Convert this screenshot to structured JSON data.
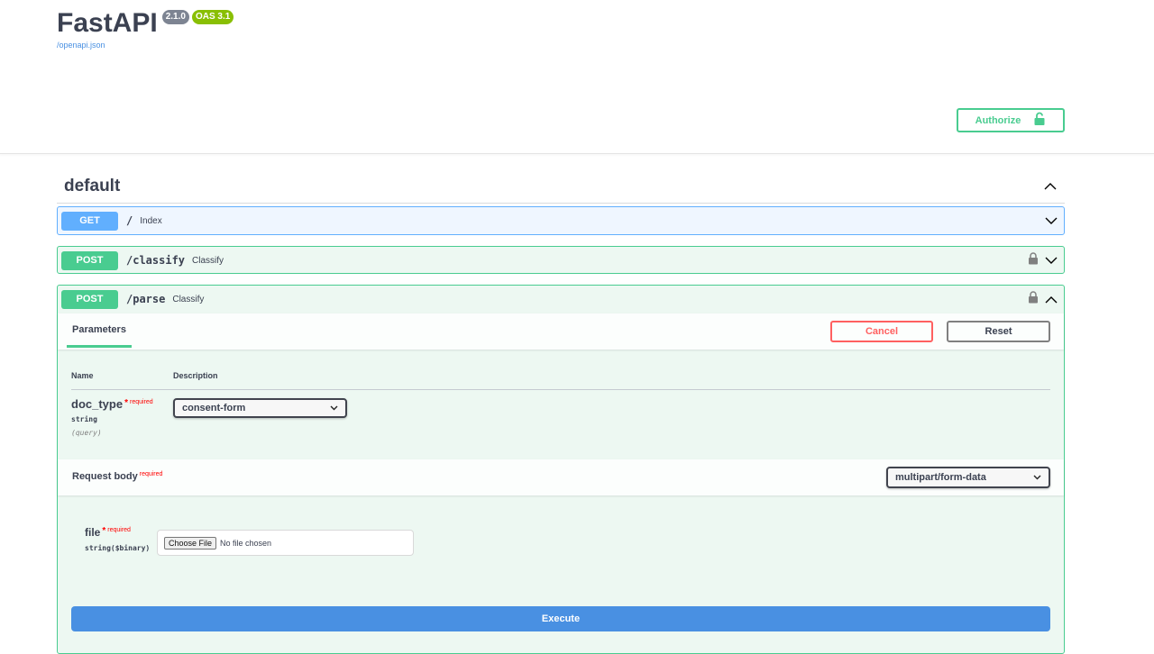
{
  "info": {
    "title": "FastAPI",
    "version": "2.1.0",
    "oas_badge": "OAS 3.1",
    "openapi_link": "/openapi.json"
  },
  "authorize": {
    "label": "Authorize"
  },
  "tag": {
    "name": "default"
  },
  "operations": [
    {
      "method": "GET",
      "path": "/",
      "summary": "Index"
    },
    {
      "method": "POST",
      "path": "/classify",
      "summary": "Classify"
    },
    {
      "method": "POST",
      "path": "/parse",
      "summary": "Classify"
    }
  ],
  "expanded": {
    "parameters_tab": "Parameters",
    "cancel_label": "Cancel",
    "reset_label": "Reset",
    "column_name": "Name",
    "column_description": "Description",
    "param": {
      "name": "doc_type",
      "required_star": "*",
      "required_text": "required",
      "type": "string",
      "in": "(query)",
      "selected_value": "consent-form"
    },
    "request_body": {
      "title": "Request body",
      "required_text": "required",
      "content_type": "multipart/form-data"
    },
    "file_field": {
      "name": "file",
      "required_star": "*",
      "required_text": "required",
      "type": "string($binary)",
      "choose_label": "Choose File",
      "no_file_text": "No file chosen"
    },
    "execute_label": "Execute"
  },
  "colors": {
    "get": "#61affe",
    "post": "#49cc90",
    "execute": "#4990e2",
    "cancel": "#ff6060"
  }
}
